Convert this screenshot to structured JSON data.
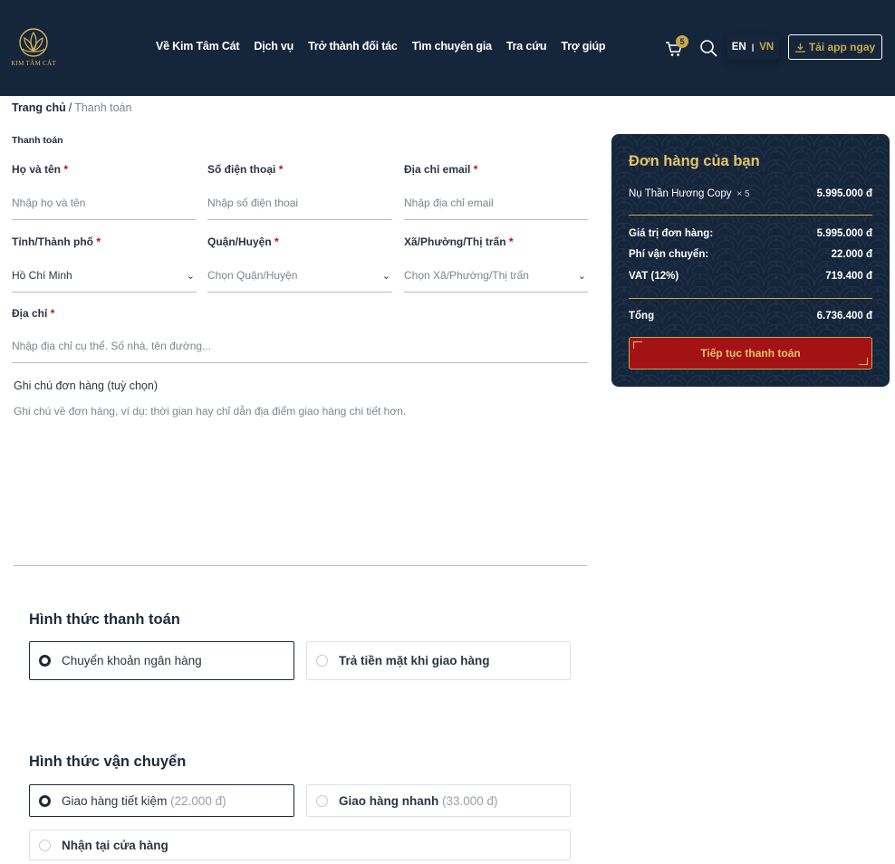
{
  "header": {
    "logo_text": "KIM TÂM CÁT",
    "nav": [
      "Về Kim Tâm Cát",
      "Dịch vụ",
      "Trở thành đối tác",
      "Tìm chuyên gia",
      "Tra cứu",
      "Trợ giúp"
    ],
    "cart_count": "5",
    "lang_en": "EN",
    "lang_sep": "|",
    "lang_vn": "VN",
    "app_button": "Tải app ngay",
    "accent_color": "#c9a84c",
    "bg_color": "#15253a"
  },
  "breadcrumb": {
    "home": "Trang chủ",
    "sep": "/",
    "current": "Thanh toán"
  },
  "form": {
    "section_title": "Thanh toán",
    "name_label": "Họ và tên",
    "name_placeholder": "Nhập họ và tên",
    "phone_label": "Số điện thoại",
    "phone_placeholder": "Nhập số điện thoại",
    "email_label": "Địa chỉ email",
    "email_placeholder": "Nhập địa chỉ email",
    "province_label": "Tỉnh/Thành phố",
    "province_value": "Hồ Chí Minh",
    "district_label": "Quận/Huyện",
    "district_placeholder": "Chọn Quận/Huyện",
    "ward_label": "Xã/Phường/Thị trấn",
    "ward_placeholder": "Chọn Xã/Phường/Thị trấn",
    "address_label": "Địa chỉ",
    "address_placeholder": "Nhập địa chỉ cụ thể. Số nhà, tên đường...",
    "required_mark": "*",
    "note_label": "Ghi chú đơn hàng (tuỳ chọn)",
    "note_placeholder": "Ghi chú về đơn hàng, ví dụ: thời gian hay chỉ dẫn địa điểm giao hàng chi tiết hơn."
  },
  "payment": {
    "title": "Hình thức thanh toán",
    "options": [
      {
        "label": "Chuyển khoản ngân hàng",
        "selected": true
      },
      {
        "label": "Trả tiền mặt khi giao hàng",
        "selected": false
      }
    ]
  },
  "shipping": {
    "title": "Hình thức vận chuyển",
    "options": [
      {
        "label": "Giao hàng tiết kiệm",
        "price": "(22.000 đ)",
        "selected": true
      },
      {
        "label": "Giao hàng nhanh",
        "price": "(33.000 đ)",
        "selected": false
      },
      {
        "label": "Nhận tại cửa hàng",
        "price": "",
        "selected": false
      }
    ]
  },
  "summary": {
    "title": "Đơn hàng của bạn",
    "product_name": "Nụ Thần Hương Copy",
    "product_qty": "× 5",
    "product_price": "5.995.000 đ",
    "subtotal_label": "Giá trị đơn hàng:",
    "subtotal_value": "5.995.000 đ",
    "shipping_label": "Phí vận chuyển:",
    "shipping_value": "22.000 đ",
    "vat_label": "VAT (12%)",
    "vat_value": "719.400 đ",
    "total_label": "Tổng",
    "total_value": "6.736.400 đ",
    "button": "Tiếp tục thanh toán",
    "button_color": "#a31214",
    "title_color": "#e5c36a"
  }
}
